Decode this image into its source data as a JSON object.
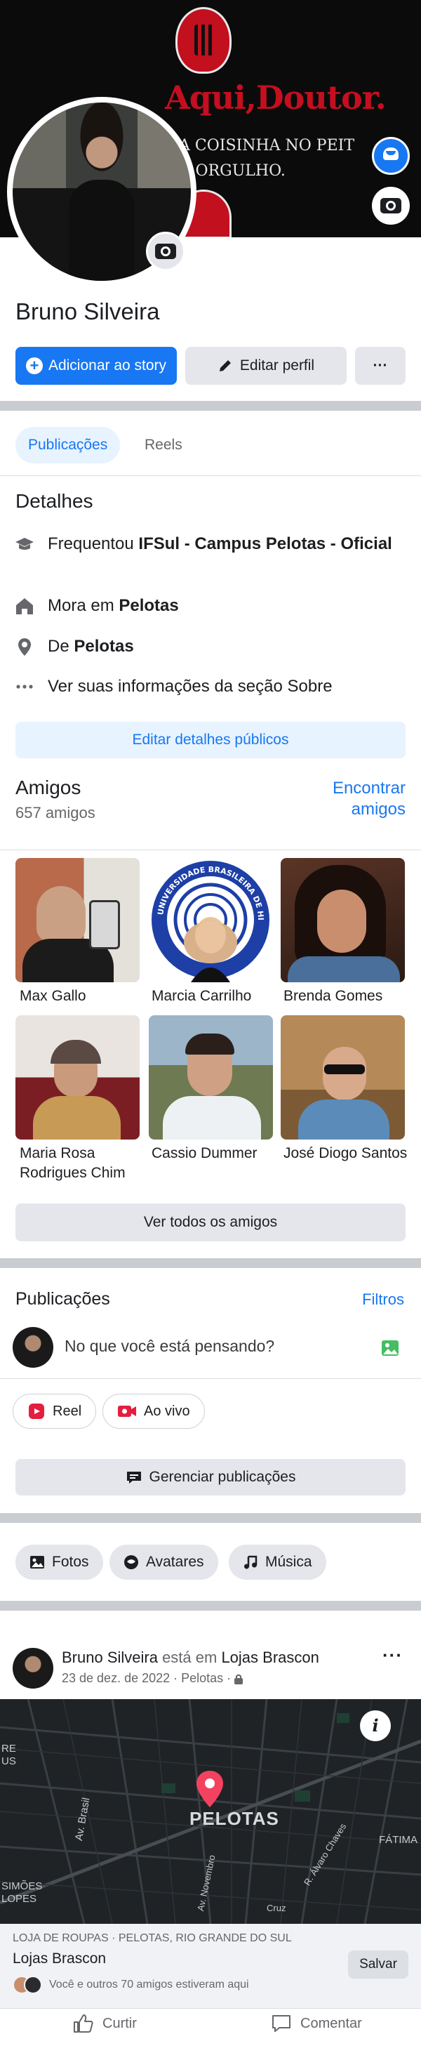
{
  "cover": {
    "title": "Aqui,Doutor.",
    "subtitle_line1": "A COISINHA NO PEIT",
    "subtitle_line2": "R ORGULHO."
  },
  "profile": {
    "name": "Bruno Silveira",
    "add_story": "Adicionar ao story",
    "edit_profile": "Editar perfil",
    "more": "···"
  },
  "tabs": [
    {
      "label": "Publicações",
      "active": true
    },
    {
      "label": "Reels",
      "active": false
    }
  ],
  "details": {
    "title": "Detalhes",
    "studied_prefix": "Frequentou ",
    "studied_place": "IFSul - Campus Pelotas - Oficial",
    "lives_prefix": "Mora em ",
    "lives_place": "Pelotas",
    "from_prefix": "De ",
    "from_place": "Pelotas",
    "about": "Ver suas informações da seção Sobre",
    "edit_public": "Editar detalhes públicos"
  },
  "friends": {
    "title": "Amigos",
    "count": "657 amigos",
    "find_line1": "Encontrar",
    "find_line2": "amigos",
    "items": [
      {
        "name": "Max Gallo"
      },
      {
        "name": "Marcia Carrilho"
      },
      {
        "name": "Brenda Gomes"
      },
      {
        "name": "Maria Rosa Rodrigues Chim"
      },
      {
        "name": "Cassio Dummer"
      },
      {
        "name": "José Diogo Santos"
      }
    ],
    "emblem_text": "UNIVERSIDADE BRASILEIRA DE HIPNOSE",
    "see_all": "Ver todos os amigos"
  },
  "posts": {
    "title": "Publicações",
    "filters": "Filtros",
    "composer_placeholder": "No que você está pensando?",
    "reel": "Reel",
    "live": "Ao vivo",
    "manage": "Gerenciar publicações"
  },
  "media_pills": [
    "Fotos",
    "Avatares",
    "Música"
  ],
  "post": {
    "author": "Bruno Silveira",
    "at": " está em ",
    "place": "Lojas Brascon",
    "date": "23 de dez. de 2022 · Pelotas · ",
    "more": "···",
    "map_city": "PELOTAS",
    "map_labels": [
      "RE",
      "US",
      "Av. Brasil",
      "SIMÕES",
      "LOPES",
      "FÁTIMA",
      "R. Álvaro Chaves",
      "Av. Novembro",
      "Cruz"
    ],
    "location_category": "LOJA DE ROUPAS · PELOTAS, RIO GRANDE DO SUL",
    "location_name": "Lojas Brascon",
    "save": "Salvar",
    "visitors": "Você e outros 70 amigos estiveram aqui",
    "like": "Curtir",
    "comment": "Comentar"
  },
  "colors": {
    "accent": "#1877f2",
    "accent_light": "#e7f3ff",
    "button_grey": "#e4e6eb",
    "divider": "#c9ccd1",
    "cover_red": "#c30f20"
  }
}
